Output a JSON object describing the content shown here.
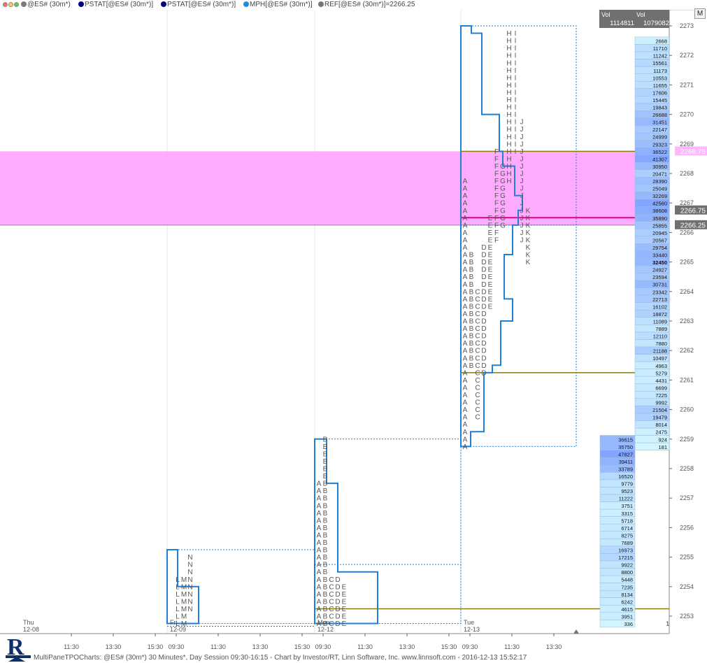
{
  "header": {
    "items": [
      {
        "icon": "ticker-icon",
        "color": "#7a7a7a",
        "label": "@ES# (30m*)"
      },
      {
        "icon": "indicator-icon",
        "color": "#00007f",
        "label": "PSTAT[@ES# (30m*)]"
      },
      {
        "icon": "indicator-icon",
        "color": "#00007f",
        "label": "PSTAT[@ES# (30m*)]"
      },
      {
        "icon": "indicator-icon",
        "color": "#1f8ed8",
        "label": "MPH[@ES# (30m*)]"
      },
      {
        "icon": "indicator-icon",
        "color": "#777777",
        "label": "REF[@ES# (30m*)]=2266.25"
      }
    ],
    "m_button": "M"
  },
  "footer": {
    "text": "MultiPaneTPOCharts: @ES# (30m*) 30 Minutes*, Day Session 09:30-16:15 - Chart by Investor/RT, Linn Software, Inc. www.linnsoft.com - 2016-12-13 15:52:17"
  },
  "colors": {
    "profile": "#1f7fd8",
    "value_area": "#1f7fd8",
    "level_line": "#8a7b10",
    "poc_line": "#e0008c",
    "band": "#ff9cff",
    "tpo_text": "#555555"
  },
  "chart_data": {
    "type": "tpo-profile",
    "symbol": "@ES#",
    "tick": 0.25,
    "y_ticks": [
      2253,
      2254,
      2255,
      2256,
      2257,
      2258,
      2259,
      2260,
      2261,
      2262,
      2263,
      2264,
      2265,
      2266,
      2267,
      2268,
      2269,
      2270,
      2271,
      2272,
      2273
    ],
    "x_ticks": [
      "11:30",
      "13:30",
      "15:30",
      "09:30",
      "11:30",
      "13:30",
      "15:30",
      "09:30",
      "11:30",
      "13:30",
      "15:30",
      "09:30",
      "11:30",
      "13:30"
    ],
    "day_labels": [
      {
        "day": "Thu",
        "date": "12-08"
      },
      {
        "day": "Fri",
        "date": "12-09"
      },
      {
        "day": "Mon",
        "date": "12-12"
      },
      {
        "day": "Tue",
        "date": "12-13"
      }
    ],
    "band": {
      "low": 2266.25,
      "high": 2268.75
    },
    "price_labels": [
      {
        "text": "2268.75",
        "price": 2268.75,
        "style": "band"
      },
      {
        "text": "2266.75",
        "price": 2266.75,
        "style": "dark"
      },
      {
        "text": "2266.25",
        "price": 2266.25,
        "style": "dark"
      }
    ],
    "vol_header": {
      "labels": [
        "Vol",
        "Vol"
      ],
      "values": [
        "1114811",
        "1079082"
      ]
    },
    "profiles": [
      {
        "name": "fri",
        "day": 1,
        "tpo": [
          {
            "l": "L",
            "t": 1,
            "low": 2252.75,
            "high": 2254.25
          },
          {
            "l": "M",
            "t": 2,
            "low": 2252.75,
            "high": 2254.25
          },
          {
            "l": "N",
            "t": 3,
            "low": 2253.25,
            "high": 2255.0
          }
        ],
        "outline": {
          "low": 2252.75,
          "high": 2255.25,
          "steps": [
            {
              "from": 2252.75,
              "w": 45
            },
            {
              "from": 2254.0,
              "w": 15
            },
            {
              "from": 2254.5,
              "w": 15
            }
          ]
        },
        "va": {
          "low": 2252.75,
          "high": 2255.25,
          "right": 2254.5
        },
        "lines": []
      },
      {
        "name": "mon",
        "day": 2,
        "tpo": [
          {
            "l": "A",
            "t": 0,
            "low": 2252.75,
            "high": 2257.5
          },
          {
            "l": "B",
            "t": 1,
            "low": 2252.75,
            "high": 2259.0
          },
          {
            "l": "C",
            "t": 2,
            "low": 2252.75,
            "high": 2254.25
          },
          {
            "l": "D",
            "t": 3,
            "low": 2252.75,
            "high": 2254.25
          },
          {
            "l": "E",
            "t": 4,
            "low": 2252.75,
            "high": 2254.0
          }
        ],
        "outline": {
          "low": 2252.75,
          "high": 2259.0,
          "steps": [
            {
              "from": 2252.75,
              "w": 90
            },
            {
              "from": 2254.5,
              "w": 33
            },
            {
              "from": 2257.5,
              "w": 17
            }
          ]
        },
        "va": {
          "low": 2252.75,
          "high": 2259.0,
          "right": 2256.5
        },
        "lines": [
          {
            "price": 2253.25,
            "kind": "level"
          }
        ]
      },
      {
        "name": "tue",
        "day": 3,
        "tpo": [
          {
            "l": "A",
            "t": 0,
            "low": 2258.75,
            "high": 2267.75
          },
          {
            "l": "B",
            "t": 1,
            "low": 2261.5,
            "high": 2265.25
          },
          {
            "l": "C",
            "t": 2,
            "low": 2259.75,
            "high": 2264.0
          },
          {
            "l": "D",
            "t": 3,
            "low": 2261.25,
            "high": 2265.5
          },
          {
            "l": "E",
            "t": 4,
            "low": 2263.5,
            "high": 2266.5
          },
          {
            "l": "F",
            "t": 5,
            "low": 2265.75,
            "high": 2268.75
          },
          {
            "l": "G",
            "t": 6,
            "low": 2266.25,
            "high": 2268.25
          },
          {
            "l": "H",
            "t": 7,
            "low": 2267.75,
            "high": 2272.75
          },
          {
            "l": "I",
            "t": 8,
            "low": 2268.75,
            "high": 2272.75
          },
          {
            "l": "J",
            "t": 9,
            "low": 2265.75,
            "high": 2269.75
          },
          {
            "l": "K",
            "t": 10,
            "low": 2265.0,
            "high": 2266.75
          }
        ],
        "outline": {
          "low": 2258.75,
          "high": 2273.0,
          "steps": [
            {
              "from": 2258.75,
              "w": 14
            },
            {
              "from": 2259.25,
              "w": 33
            },
            {
              "from": 2261.25,
              "w": 45
            },
            {
              "from": 2261.5,
              "w": 57
            },
            {
              "from": 2263.0,
              "w": 74
            },
            {
              "from": 2263.75,
              "w": 62
            },
            {
              "from": 2265.25,
              "w": 74
            },
            {
              "from": 2266.25,
              "w": 82
            },
            {
              "from": 2266.75,
              "w": 88
            },
            {
              "from": 2267.25,
              "w": 77
            },
            {
              "from": 2268.25,
              "w": 60
            },
            {
              "from": 2268.75,
              "w": 55
            },
            {
              "from": 2270.0,
              "w": 30
            },
            {
              "from": 2272.75,
              "w": 15
            }
          ]
        },
        "va": {
          "low": 2258.75,
          "high": 2273.0,
          "right": 2265.5
        },
        "lines": [
          {
            "price": 2268.75,
            "kind": "level"
          },
          {
            "price": 2261.25,
            "kind": "level"
          },
          {
            "price": 2266.5,
            "kind": "poc"
          }
        ]
      }
    ],
    "volume_ladder": [
      {
        "low": 2252.75,
        "high": 2259.0,
        "values": [
          336,
          3951,
          4615,
          6242,
          8134,
          7235,
          5448,
          8800,
          9922,
          17215,
          16973,
          7689,
          8275,
          6714,
          5718,
          3315,
          3751,
          11222,
          9523,
          9779,
          16520,
          33789,
          39411,
          47827,
          35750,
          36615
        ],
        "right_label": "1"
      },
      {
        "low": 2258.75,
        "high": 2273.0,
        "values": [
          181,
          924,
          2475,
          8014,
          19479,
          21504,
          9992,
          7225,
          6699,
          4431,
          5279,
          4963,
          10497,
          21188,
          7880,
          12110,
          7889,
          11089,
          18872,
          16102,
          22713,
          23342,
          30731,
          23594,
          24927,
          32450,
          33440,
          29754,
          20567,
          20945,
          25855,
          35890,
          38608,
          42560,
          32269,
          25049,
          28390,
          20471,
          30950,
          41307,
          36522,
          29323,
          24999,
          22147,
          31451,
          26688,
          19843,
          15445,
          17606,
          11655,
          10553,
          11173,
          15561,
          11242,
          11710,
          2668
        ]
      }
    ]
  }
}
